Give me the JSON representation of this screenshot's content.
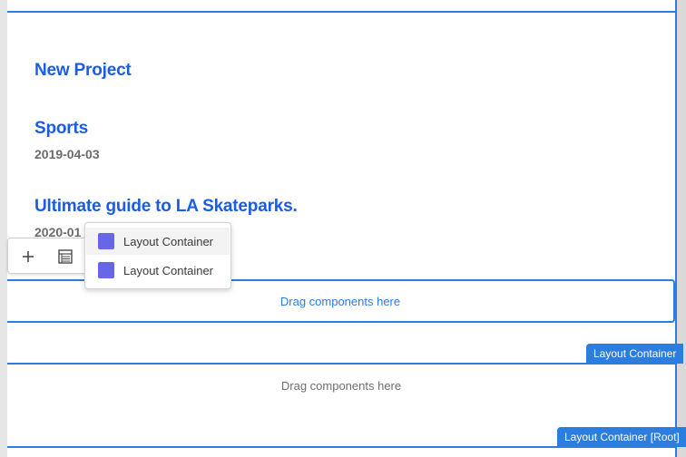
{
  "colors": {
    "accent": "#2b7de0",
    "title_link": "#1a5ce6",
    "component_swatch": "#6666e6"
  },
  "list": {
    "items": [
      {
        "title": "New Project",
        "date": ""
      },
      {
        "title": "Sports",
        "date": "2019-04-03"
      },
      {
        "title": "Ultimate guide to LA Skateparks.",
        "date": "2020-01"
      }
    ]
  },
  "toolbar": {
    "insert_icon": "plus-icon",
    "properties_icon": "table-icon"
  },
  "component_picker": {
    "options": [
      {
        "label": "Layout Container",
        "icon": "layout-container-icon"
      },
      {
        "label": "Layout Container",
        "icon": "layout-container-icon"
      }
    ]
  },
  "drop_zones": {
    "active_placeholder": "Drag components here",
    "root_placeholder": "Drag components here"
  },
  "tags": {
    "container_tag": "Layout Container",
    "root_tag": "Layout Container [Root]"
  }
}
